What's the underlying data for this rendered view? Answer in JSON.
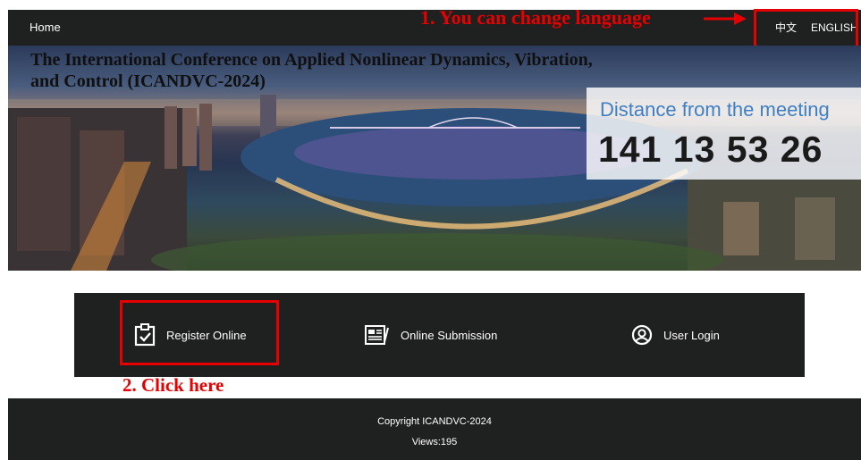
{
  "nav": {
    "home": "Home",
    "lang_zh": "中文",
    "lang_en": "ENGLISH"
  },
  "annotations": {
    "step1": "1. You can change language",
    "step2": "2. Click here",
    "color": "#e60000"
  },
  "banner": {
    "title": "The International Conference on Applied Nonlinear Dynamics, Vibration, and Control (ICANDVC-2024)",
    "countdown_label": "Distance from the meeting",
    "countdown_value": "141 13 53 26"
  },
  "actions": [
    {
      "label": "Register Online",
      "icon": "clipboard-check-icon"
    },
    {
      "label": "Online Submission",
      "icon": "document-edit-icon"
    },
    {
      "label": "User Login",
      "icon": "user-circle-icon"
    }
  ],
  "footer": {
    "copyright": "Copyright ICANDVC-2024",
    "views": "Views:195"
  },
  "colors": {
    "bar_bg": "#1f2020",
    "countdown_label": "#3f7fc4",
    "annotation": "#e60000"
  }
}
